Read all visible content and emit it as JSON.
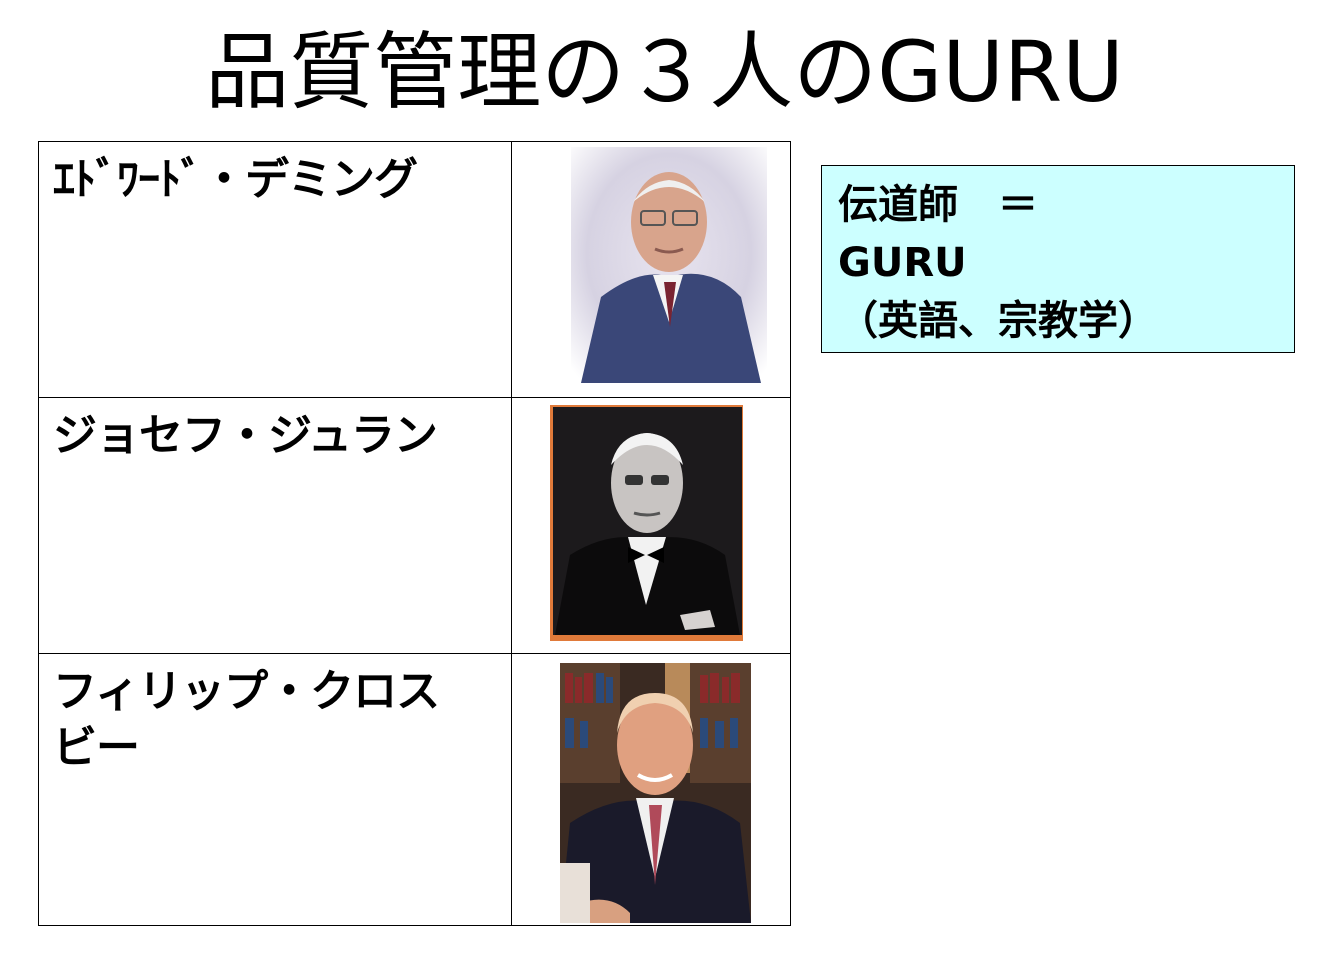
{
  "title": "品質管理の３人のGURU",
  "gurus": [
    {
      "name": "ｴﾄﾞﾜｰﾄﾞ・デミング",
      "photo_icon": "portrait-photo-deming"
    },
    {
      "name": "ジョセフ・ジュラン",
      "photo_icon": "portrait-photo-juran"
    },
    {
      "name": "フィリップ・クロスビー",
      "photo_icon": "portrait-photo-crosby"
    }
  ],
  "note": {
    "line1": "伝道師　＝",
    "line2": "GURU",
    "line3": "（英語、宗教学）"
  },
  "colors": {
    "note_background": "#ccffff",
    "border": "#000000"
  }
}
